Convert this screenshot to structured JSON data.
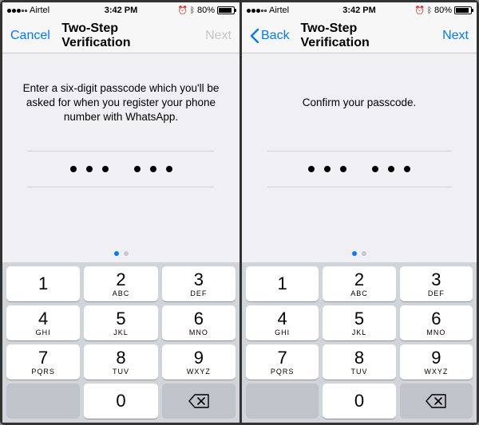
{
  "screens": [
    {
      "status": {
        "carrier": "Airtel",
        "time": "3:42 PM",
        "battery_pct": "80%"
      },
      "nav": {
        "left_label": "Cancel",
        "left_type": "text",
        "title": "Two-Step Verification",
        "right_label": "Next",
        "right_enabled": false
      },
      "prompt": "Enter a six-digit passcode which you'll be asked for when you register your phone number with WhatsApp.",
      "passcode_filled": 6,
      "page_index": 0
    },
    {
      "status": {
        "carrier": "Airtel",
        "time": "3:42 PM",
        "battery_pct": "80%"
      },
      "nav": {
        "left_label": "Back",
        "left_type": "back",
        "title": "Two-Step Verification",
        "right_label": "Next",
        "right_enabled": true
      },
      "prompt": "Confirm your passcode.",
      "passcode_filled": 6,
      "page_index": 0
    }
  ],
  "page_count": 2,
  "keypad": [
    {
      "digit": "1",
      "letters": ""
    },
    {
      "digit": "2",
      "letters": "ABC"
    },
    {
      "digit": "3",
      "letters": "DEF"
    },
    {
      "digit": "4",
      "letters": "GHI"
    },
    {
      "digit": "5",
      "letters": "JKL"
    },
    {
      "digit": "6",
      "letters": "MNO"
    },
    {
      "digit": "7",
      "letters": "PQRS"
    },
    {
      "digit": "8",
      "letters": "TUV"
    },
    {
      "digit": "9",
      "letters": "WXYZ"
    }
  ],
  "keypad_zero": {
    "digit": "0",
    "letters": ""
  },
  "colors": {
    "tint": "#007aff",
    "disabled": "#c7c7cc"
  }
}
